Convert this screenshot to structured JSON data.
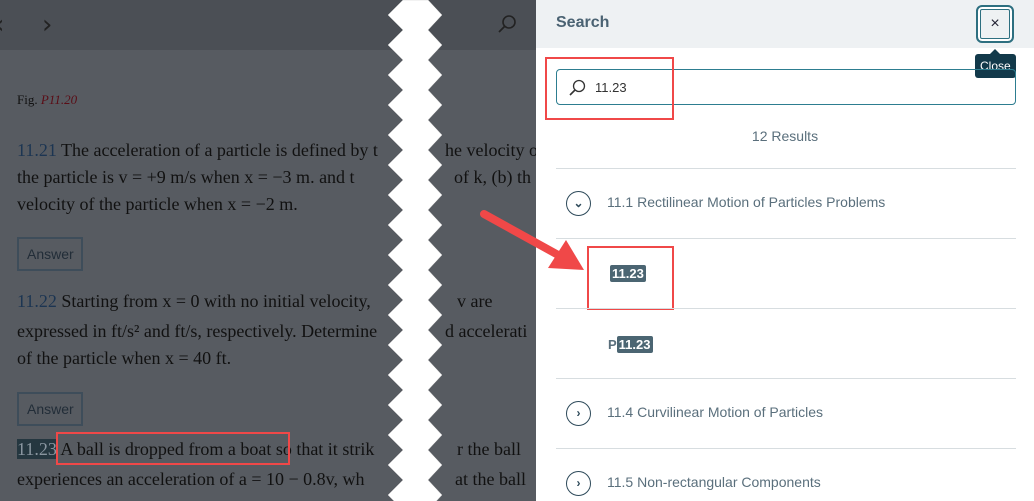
{
  "reader": {
    "nav_prev": "‹",
    "nav_next": "›",
    "search_icon": "search-icon",
    "fig_prefix": "Fig. ",
    "fig_label": "P11.20",
    "p1_num": "11.21",
    "p1_lines": [
      "The acceleration of a particle is defined by t",
      "he velocity o",
      "the particle is v = +9 m/s when x = −3 m. and t",
      "of k, (b) th",
      "velocity of the particle when x = −2 m."
    ],
    "answer_label": "Answer",
    "p2_num": "11.22",
    "p2_lines": [
      "Starting from x = 0 with no initial velocity,",
      "v are",
      "expressed in ft/s² and ft/s, respectively. Determine",
      "d accelerati",
      "of the particle when x = 40 ft."
    ],
    "p3_num": "11.23",
    "p3_lines": [
      "A ball is dropped from a boat so that it strik",
      "r the ball",
      "experiences an acceleration of a = 10 − 0.8v, wh",
      "at the ball"
    ]
  },
  "panel": {
    "title": "Search",
    "close_label": "×",
    "close_tooltip": "Close",
    "search_value": "11.23",
    "results_count": "12 Results",
    "sections": [
      {
        "label": "11.1 Rectilinear Motion of Particles Problems",
        "expanded": true,
        "results": [
          {
            "prefix": "",
            "match": "11.23"
          },
          {
            "prefix": "P",
            "match": "11.23"
          }
        ]
      },
      {
        "label": "11.4 Curvilinear Motion of Particles",
        "expanded": false
      },
      {
        "label": "11.5 Non-rectangular Components",
        "expanded": false
      }
    ]
  },
  "colors": {
    "annotation": "#f04848",
    "accent": "#2d6f80"
  }
}
